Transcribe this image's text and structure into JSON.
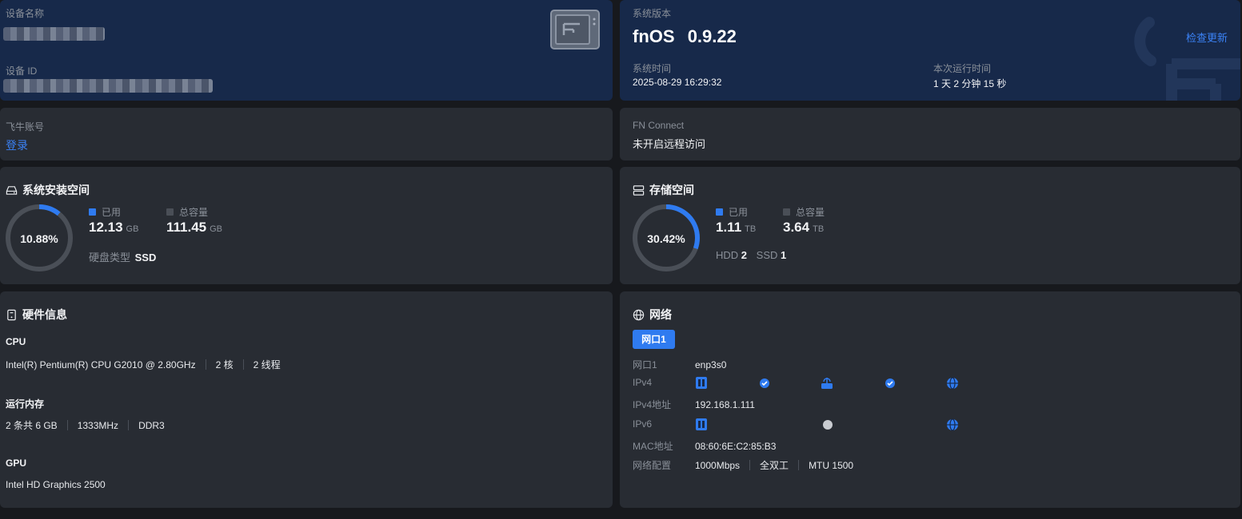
{
  "device": {
    "name_label": "设备名称",
    "id_label": "设备 ID"
  },
  "system": {
    "version_label": "系统版本",
    "os_name": "fnOS",
    "os_version": "0.9.22",
    "check_update": "检查更新",
    "time_label": "系统时间",
    "time_value": "2025-08-29 16:29:32",
    "uptime_label": "本次运行时间",
    "uptime_value": "1 天 2 分钟 15 秒"
  },
  "account": {
    "label": "飞牛账号",
    "login": "登录"
  },
  "fnconnect": {
    "label": "FN Connect",
    "status": "未开启远程访问"
  },
  "system_space": {
    "title": "系统安装空间",
    "percent_text": "10.88%",
    "percent": 10.88,
    "used_label": "已用",
    "used_value": "12.13",
    "used_unit": "GB",
    "total_label": "总容量",
    "total_value": "111.45",
    "total_unit": "GB",
    "disk_type_label": "硬盘类型",
    "disk_type_value": "SSD"
  },
  "storage": {
    "title": "存储空间",
    "percent_text": "30.42%",
    "percent": 30.42,
    "used_label": "已用",
    "used_value": "1.11",
    "used_unit": "TB",
    "total_label": "总容量",
    "total_value": "3.64",
    "total_unit": "TB",
    "hdd_label": "HDD",
    "hdd_count": "2",
    "ssd_label": "SSD",
    "ssd_count": "1"
  },
  "hardware": {
    "title": "硬件信息",
    "cpu_label": "CPU",
    "cpu_model": "Intel(R) Pentium(R) CPU G2010 @ 2.80GHz",
    "cpu_cores": "2 核",
    "cpu_threads": "2 线程",
    "ram_label": "运行内存",
    "ram_total": "2 条共 6 GB",
    "ram_speed": "1333MHz",
    "ram_type": "DDR3",
    "gpu_label": "GPU",
    "gpu_model": "Intel HD Graphics 2500"
  },
  "network": {
    "title": "网络",
    "tab": "网口1",
    "port_label": "网口1",
    "port_value": "enp3s0",
    "ipv4_label": "IPv4",
    "ipv4_addr_label": "IPv4地址",
    "ipv4_addr_value": "192.168.1.111",
    "ipv6_label": "IPv6",
    "mac_label": "MAC地址",
    "mac_value": "08:60:6E:C2:85:B3",
    "config_label": "网络配置",
    "speed": "1000Mbps",
    "duplex": "全双工",
    "mtu": "MTU 1500"
  },
  "colors": {
    "accent": "#2f7bf0",
    "ring_track": "#4a4f57",
    "card": "#282c33",
    "card_blue": "#17294a"
  }
}
